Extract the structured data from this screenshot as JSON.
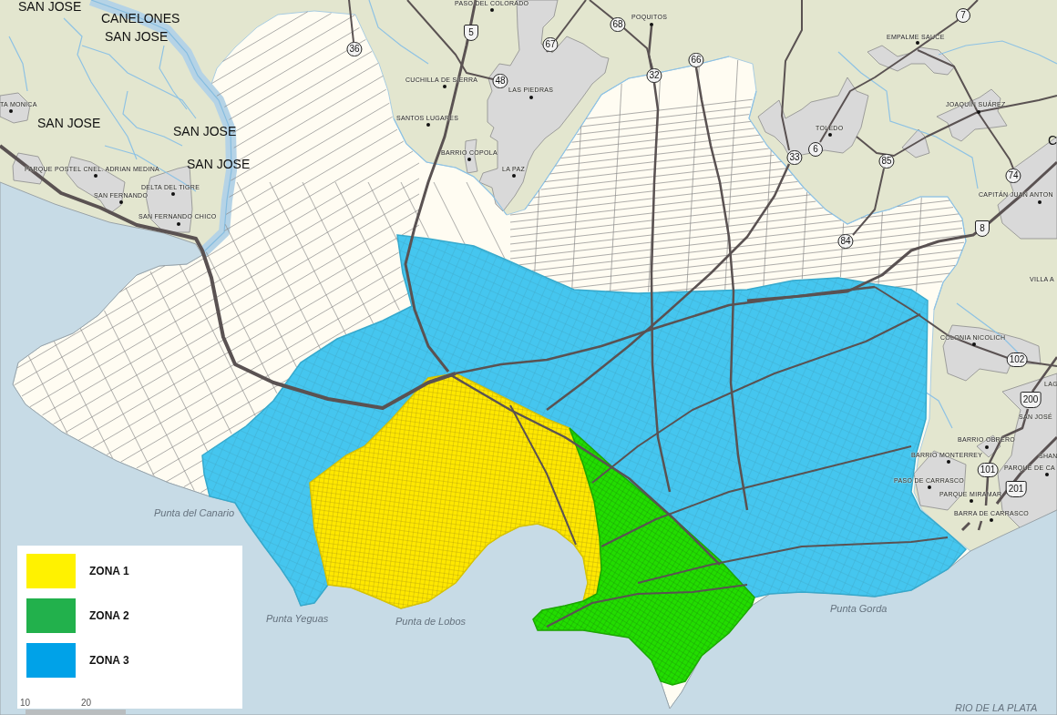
{
  "map": {
    "regions": [
      "SAN JOSE",
      "CANELONES",
      "SAN JOSE",
      "SAN JOSE",
      "SAN JOSE",
      "SAN JOSE",
      "C"
    ],
    "towns": [
      {
        "name": "TA MONICA",
        "kind": "marked"
      },
      {
        "name": "PARQUE POSTEL CNEL. ADRIAN MEDINA",
        "kind": "marked"
      },
      {
        "name": "DELTA DEL TIGRE",
        "kind": "marked"
      },
      {
        "name": "SAN FERNANDO",
        "kind": "marked"
      },
      {
        "name": "SAN FERNANDO CHICO",
        "kind": "marked"
      },
      {
        "name": "PASO DEL COLORADO",
        "kind": "marked"
      },
      {
        "name": "POQUITOS",
        "kind": "marked"
      },
      {
        "name": "CUCHILLA DE SIERRA",
        "kind": "marked"
      },
      {
        "name": "LAS PIEDRAS",
        "kind": "marked"
      },
      {
        "name": "SANTOS LUGARES",
        "kind": "marked"
      },
      {
        "name": "BARRIO COPOLA",
        "kind": "marked"
      },
      {
        "name": "LA PAZ",
        "kind": "marked"
      },
      {
        "name": "EMPALME SAUCE",
        "kind": "marked"
      },
      {
        "name": "JOAQUÍN SUÁREZ",
        "kind": "marked"
      },
      {
        "name": "TOLEDO",
        "kind": "marked"
      },
      {
        "name": "CAPITÁN JUAN ANTON",
        "kind": "marked"
      },
      {
        "name": "VILLA A",
        "kind": "unmarked"
      },
      {
        "name": "COLONIA NICOLICH",
        "kind": "marked"
      },
      {
        "name": "LAG",
        "kind": "unmarked"
      },
      {
        "name": "SAN JOSÉ",
        "kind": "unmarked"
      },
      {
        "name": "BARRIO OBRERO",
        "kind": "marked"
      },
      {
        "name": "BARRIO MONTERREY",
        "kind": "marked"
      },
      {
        "name": "SHAN",
        "kind": "unmarked"
      },
      {
        "name": "PARQUE DE CA",
        "kind": "marked"
      },
      {
        "name": "PASO DE CARRASCO",
        "kind": "marked"
      },
      {
        "name": "PARQUE MIRAMAR",
        "kind": "marked"
      },
      {
        "name": "BARRA DE CARRASCO",
        "kind": "marked"
      }
    ],
    "route_markers": [
      {
        "number": "36",
        "kind": "circle"
      },
      {
        "number": "5",
        "kind": "shield"
      },
      {
        "number": "67",
        "kind": "circle"
      },
      {
        "number": "68",
        "kind": "circle"
      },
      {
        "number": "48",
        "kind": "circle"
      },
      {
        "number": "32",
        "kind": "circle"
      },
      {
        "number": "66",
        "kind": "circle"
      },
      {
        "number": "7",
        "kind": "circle"
      },
      {
        "number": "33",
        "kind": "circle"
      },
      {
        "number": "6",
        "kind": "circle"
      },
      {
        "number": "85",
        "kind": "circle"
      },
      {
        "number": "74",
        "kind": "circle"
      },
      {
        "number": "8",
        "kind": "shield"
      },
      {
        "number": "84",
        "kind": "circle"
      },
      {
        "number": "102",
        "kind": "circle"
      },
      {
        "number": "200",
        "kind": "shield"
      },
      {
        "number": "101",
        "kind": "circle"
      },
      {
        "number": "201",
        "kind": "shield"
      }
    ],
    "landmarks": [
      "Punta del Canario",
      "Punta Yeguas",
      "Punta de Lobos",
      "Punta Gorda"
    ],
    "water_labels": [
      "RIO DE LA PLATA"
    ]
  },
  "legend": {
    "items": [
      {
        "label": "ZONA 1",
        "color": "#fff200"
      },
      {
        "label": "ZONA 2",
        "color": "#22b14c"
      },
      {
        "label": "ZONA 3",
        "color": "#00a2e8"
      }
    ]
  },
  "scale_bar": {
    "labels": [
      "10",
      "20"
    ]
  }
}
